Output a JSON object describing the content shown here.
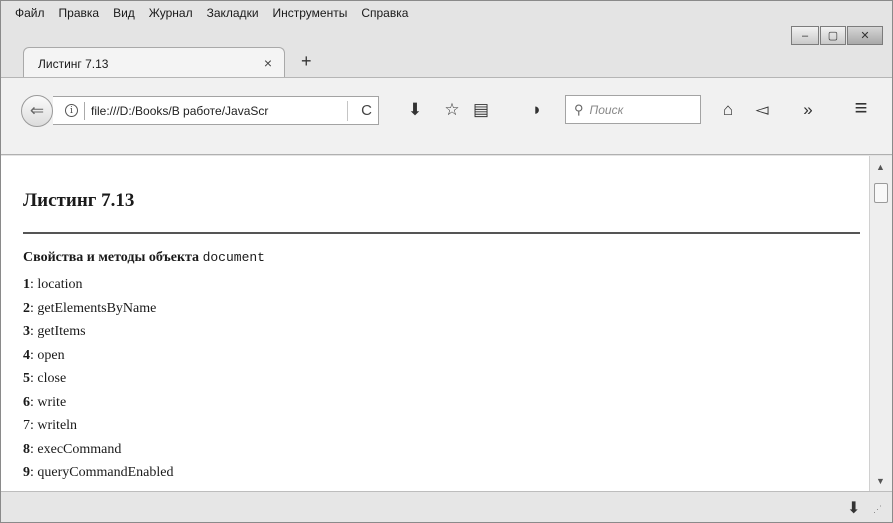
{
  "menu": [
    "Файл",
    "Правка",
    "Вид",
    "Журнал",
    "Закладки",
    "Инструменты",
    "Справка"
  ],
  "window_controls": {
    "minimize": "–",
    "maximize": "▢",
    "close": "✕"
  },
  "tab": {
    "title": "Листинг 7.13",
    "close": "×",
    "new_tab": "+"
  },
  "navbar": {
    "back": "⇐",
    "info": "i",
    "url": "file:///D:/Books/В работе/JavaScr",
    "reload": "C",
    "download": "⬇",
    "bookmark": "☆",
    "reader": "▤",
    "pocket": "◗",
    "search_placeholder": "Поиск",
    "home": "⌂",
    "share": "◅",
    "overflow": "»",
    "menu": "≡"
  },
  "page": {
    "title": "Листинг 7.13",
    "subtitle": "Свойства и методы объекта",
    "subtitle_code": "document",
    "items": [
      {
        "num": "1",
        "name": ": location"
      },
      {
        "num": "2",
        "name": ": getElementsByName"
      },
      {
        "num": "3",
        "name": ": getItems"
      },
      {
        "num": "4",
        "name": ": open"
      },
      {
        "num": "5",
        "name": ": close"
      },
      {
        "num": "6",
        "name": ": write"
      },
      {
        "num": "7",
        "name": ": writeln"
      },
      {
        "num": "8",
        "name": ": execCommand"
      },
      {
        "num": "9",
        "name": ": queryCommandEnabled"
      }
    ]
  },
  "icons": {
    "scroll_up": "▲",
    "scroll_down": "▼",
    "downloads": "⬇",
    "grip": "⋰"
  }
}
